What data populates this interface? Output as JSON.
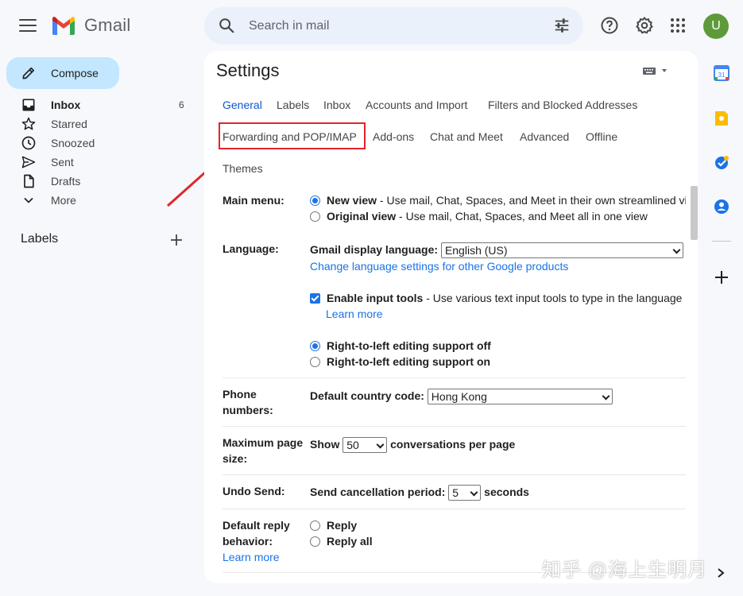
{
  "app": {
    "name": "Gmail"
  },
  "search": {
    "placeholder": "Search in mail"
  },
  "user": {
    "avatar_letter": "U",
    "avatar_color": "#5e9a3a"
  },
  "compose": {
    "label": "Compose"
  },
  "nav": {
    "items": [
      {
        "label": "Inbox",
        "count": "6",
        "icon": "inbox-icon"
      },
      {
        "label": "Starred",
        "icon": "star-icon"
      },
      {
        "label": "Snoozed",
        "icon": "clock-icon"
      },
      {
        "label": "Sent",
        "icon": "send-icon"
      },
      {
        "label": "Drafts",
        "icon": "draft-icon"
      },
      {
        "label": "More",
        "icon": "chevron-down-icon"
      }
    ],
    "labels_heading": "Labels"
  },
  "settings": {
    "title": "Settings",
    "tabs": [
      "General",
      "Labels",
      "Inbox",
      "Accounts and Import",
      "Filters and Blocked Addresses",
      "Forwarding and POP/IMAP",
      "Add-ons",
      "Chat and Meet",
      "Advanced",
      "Offline",
      "Themes"
    ],
    "active_tab": "General",
    "highlighted_tab": "Forwarding and POP/IMAP",
    "main_menu": {
      "label": "Main menu:",
      "new_view": "New view",
      "new_view_desc": " - Use mail, Chat, Spaces, and Meet in their own streamlined vi",
      "original_view": "Original view",
      "original_view_desc": " - Use mail, Chat, Spaces, and Meet all in one view"
    },
    "language": {
      "label": "Language:",
      "display_label": "Gmail display language:",
      "display_value": "English (US)",
      "change_link": "Change language settings for other Google products",
      "input_tools": "Enable input tools",
      "input_tools_desc": " - Use various text input tools to type in the language",
      "learn_more": "Learn more",
      "rtl_off": "Right-to-left editing support off",
      "rtl_on": "Right-to-left editing support on"
    },
    "phone": {
      "label_line1": "Phone",
      "label_line2": "numbers:",
      "country_label": "Default country code:",
      "country_value": "Hong Kong"
    },
    "page_size": {
      "label_line1": "Maximum page",
      "label_line2": "size:",
      "show": "Show",
      "value": "50",
      "suffix": "conversations per page"
    },
    "undo": {
      "label": "Undo Send:",
      "period_label": "Send cancellation period:",
      "value": "5",
      "suffix": "seconds"
    },
    "reply": {
      "label_line1": "Default reply",
      "label_line2": "behavior:",
      "learn_more": "Learn more",
      "reply": "Reply",
      "reply_all": "Reply all"
    }
  },
  "watermark": "知乎 @海上生明月",
  "colors": {
    "accent": "#0b57d0",
    "compose_bg": "#c2e7ff",
    "highlight": "#e3242b"
  }
}
